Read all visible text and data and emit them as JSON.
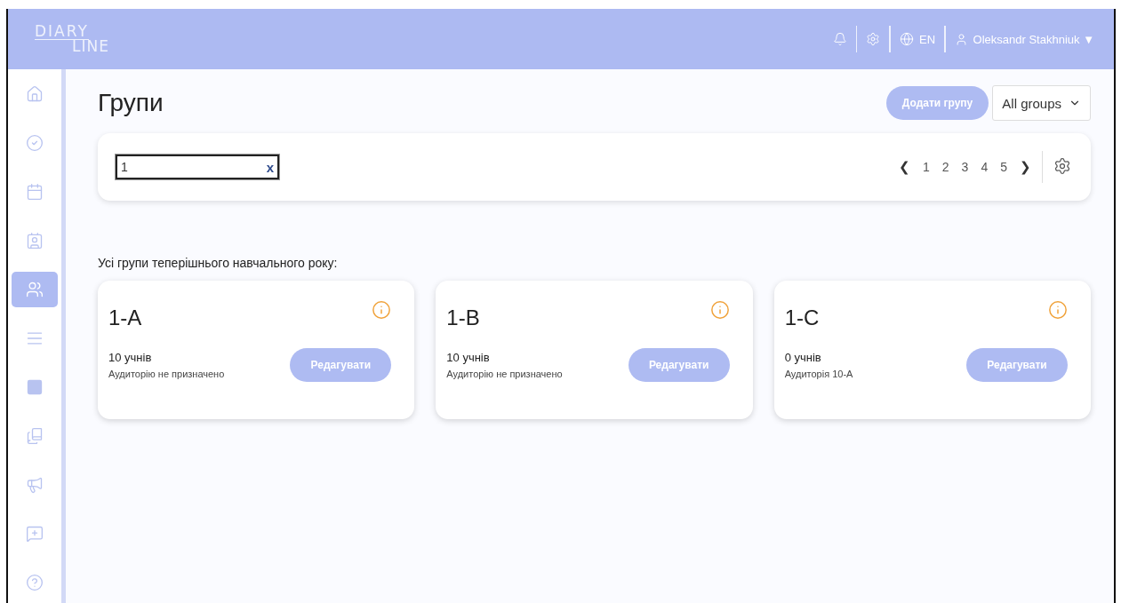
{
  "logo": {
    "top": "DIARY",
    "bottom": "LINE"
  },
  "header": {
    "language": "EN",
    "user": "Oleksandr Stakhniuk",
    "user_caret": "▼"
  },
  "sidebar": {
    "items": [
      {
        "kind": "home",
        "selected": false
      },
      {
        "kind": "check",
        "selected": false
      },
      {
        "kind": "calendar",
        "selected": false
      },
      {
        "kind": "badge",
        "selected": false
      },
      {
        "kind": "users",
        "selected": true
      },
      {
        "kind": "lines",
        "selected": false
      },
      {
        "kind": "square",
        "selected": false
      },
      {
        "kind": "books",
        "selected": false
      },
      {
        "kind": "megaphone",
        "selected": false
      },
      {
        "kind": "message",
        "selected": false
      },
      {
        "kind": "help",
        "selected": false
      }
    ]
  },
  "page": {
    "title": "Групи",
    "add_button": "Додати групу",
    "filter": "All groups"
  },
  "search": {
    "value": "1",
    "clear": "x"
  },
  "pagination": {
    "prev": "❮",
    "pages": [
      "1",
      "2",
      "3",
      "4",
      "5"
    ],
    "next": "❯"
  },
  "section_title": "Усі групи теперішнього навчального року:",
  "groups": [
    {
      "name": "1-A",
      "students": "10 учнів",
      "room": "Аудиторію не призначено",
      "edit": "Редагувати"
    },
    {
      "name": "1-B",
      "students": "10 учнів",
      "room": "Аудиторію не призначено",
      "edit": "Редагувати"
    },
    {
      "name": "1-C",
      "students": "0 учнів",
      "room": "Аудиторія 10-A",
      "edit": "Редагувати"
    }
  ]
}
